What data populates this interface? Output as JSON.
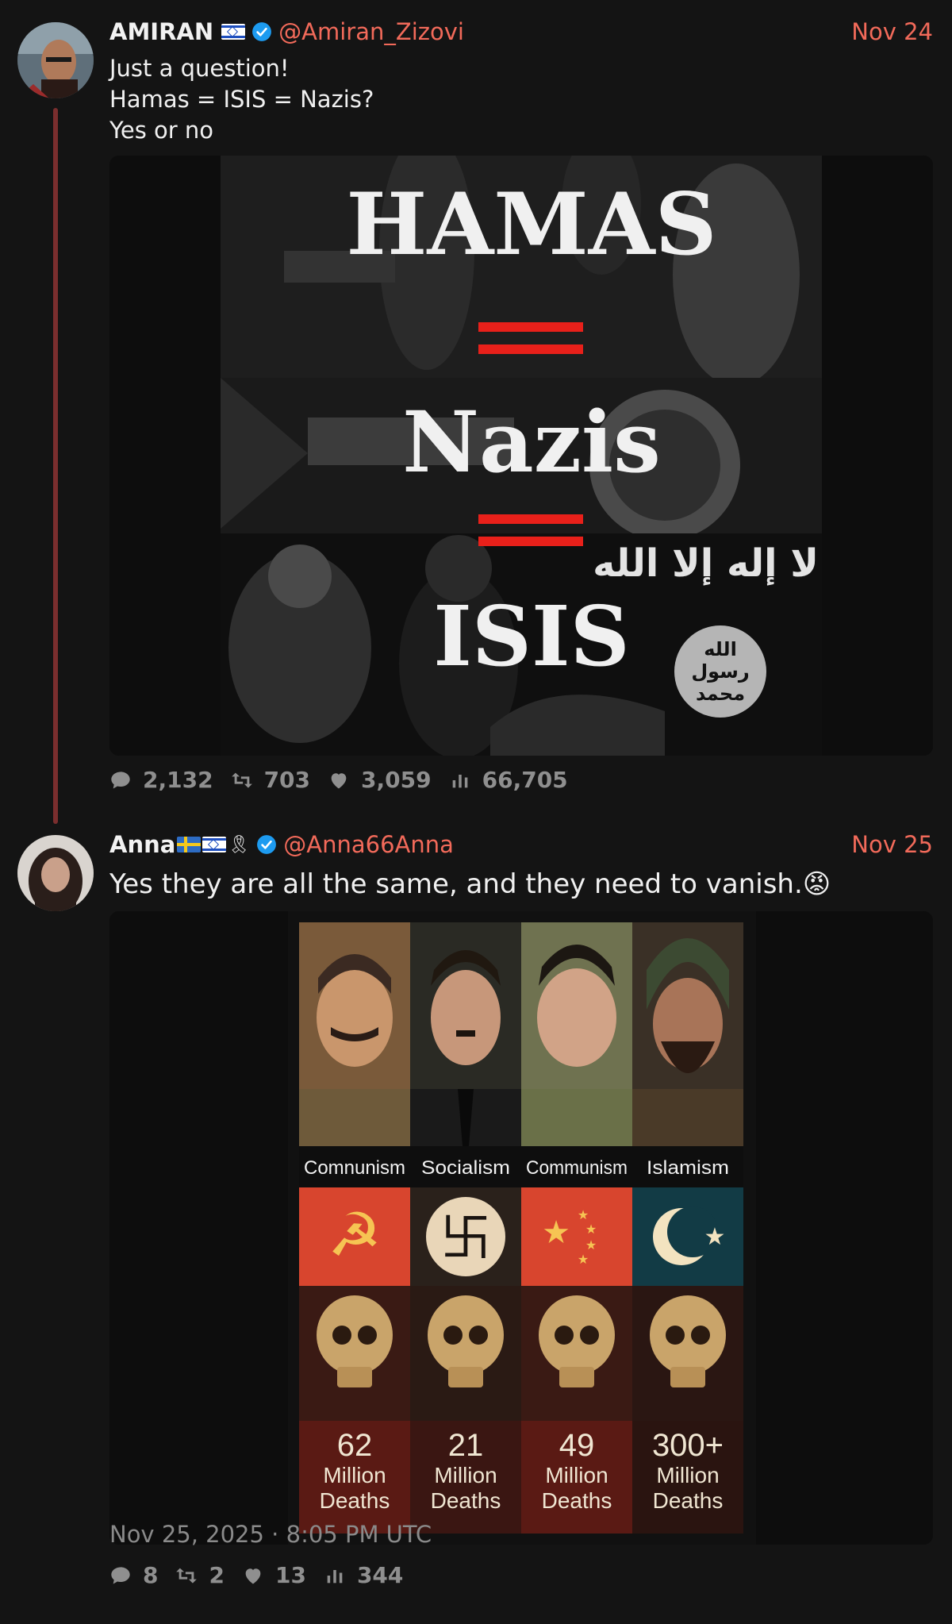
{
  "tweets": [
    {
      "author_name": "AMIRAN",
      "handle": "@Amiran_Zizovi",
      "date": "Nov 24",
      "text_lines": [
        "Just a question!",
        "Hamas = ISIS = Nazis?",
        "Yes or no"
      ],
      "image": {
        "words": [
          "HAMAS",
          "Nazis",
          "ISIS"
        ],
        "arabic_banner": "لا إله إلا الله",
        "seal_lines": [
          "الله",
          "رسول",
          "محمد"
        ]
      },
      "stats": {
        "replies": "2,132",
        "retweets": "703",
        "likes": "3,059",
        "views": "66,705"
      }
    },
    {
      "author_name": "Anna",
      "handle": "@Anna66Anna",
      "date": "Nov 25",
      "text": "Yes they are all the same, and they need to vanish.😡",
      "image": {
        "columns": [
          {
            "ideology": "Comnunism",
            "count": "62",
            "unit": "Million",
            "deaths": "Deaths",
            "symbol_bg": "#d8452e"
          },
          {
            "ideology": "Socialism",
            "count": "21",
            "unit": "Million",
            "deaths": "Deaths",
            "symbol_bg": "#2a211b"
          },
          {
            "ideology": "Communism",
            "count": "49",
            "unit": "Million",
            "deaths": "Deaths",
            "symbol_bg": "#d8452e"
          },
          {
            "ideology": "Islamism",
            "count": "300+",
            "unit": "Million",
            "deaths": "Deaths",
            "symbol_bg": "#123b45"
          }
        ]
      },
      "timestamp": "Nov 25, 2025 · 8:05 PM UTC",
      "stats": {
        "replies": "8",
        "retweets": "2",
        "likes": "13",
        "views": "344"
      }
    }
  ],
  "colors": {
    "background": "#141414",
    "accent": "#f26a5a",
    "thread_line": "#7a2e2e",
    "verified": "#1d9bf0",
    "muted": "#8f8f8f"
  },
  "icons": [
    "comment-icon",
    "retweet-icon",
    "heart-icon",
    "views-icon",
    "verified-badge-icon"
  ]
}
